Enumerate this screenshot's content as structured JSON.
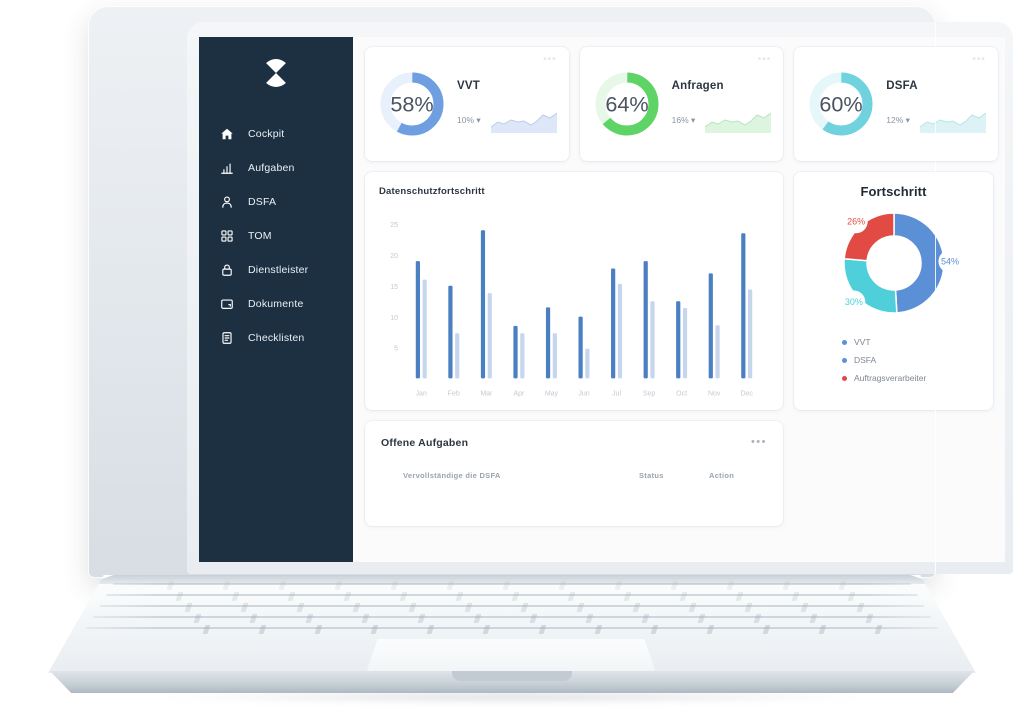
{
  "sidebar": {
    "logo_name": "brand-logo",
    "items": [
      {
        "label": "Cockpit",
        "icon": "home-icon"
      },
      {
        "label": "Aufgaben",
        "icon": "bar-chart-icon"
      },
      {
        "label": "DSFA",
        "icon": "user-icon"
      },
      {
        "label": "TOM",
        "icon": "grid-icon"
      },
      {
        "label": "Dienstleister",
        "icon": "lock-icon"
      },
      {
        "label": "Dokumente",
        "icon": "folder-icon"
      },
      {
        "label": "Checklisten",
        "icon": "document-icon"
      }
    ]
  },
  "stat_cards": [
    {
      "title": "VVT",
      "percent": "58%",
      "value": 58,
      "delta": "10% ▾",
      "color": "#6f9fe0",
      "track": "#e8f0fb",
      "menu": "•••"
    },
    {
      "title": "Anfragen",
      "percent": "64%",
      "value": 64,
      "delta": "16% ▾",
      "color": "#5ed366",
      "track": "#e7f8e9",
      "menu": "•••"
    },
    {
      "title": "DSFA",
      "percent": "60%",
      "value": 60,
      "delta": "12% ▾",
      "color": "#6fd2de",
      "track": "#e6f7fa",
      "menu": "•••"
    }
  ],
  "chart_data": [
    {
      "type": "bar",
      "title": "Datenschutzfortschritt",
      "categories": [
        "Jan",
        "Feb",
        "Mar",
        "Apr",
        "May",
        "Jun",
        "Jul",
        "Sep",
        "Oct",
        "Nov",
        "Dec"
      ],
      "series": [
        {
          "name": "primary",
          "color": "#4a7fc1",
          "values": [
            19,
            15,
            24,
            8.5,
            11.5,
            10,
            17.8,
            19,
            12.5,
            17,
            23.5
          ]
        },
        {
          "name": "secondary",
          "color": "#c6d7ed",
          "values": [
            16,
            7.3,
            13.8,
            7.3,
            7.3,
            4.8,
            15.3,
            12.5,
            11.4,
            8.6,
            14.4
          ]
        }
      ],
      "yticks": [
        5,
        10,
        15,
        20,
        25
      ],
      "ylim": [
        0,
        27
      ],
      "xlabel": "",
      "ylabel": "",
      "grid": false,
      "legend": "none"
    },
    {
      "type": "pie",
      "title": "Fortschritt",
      "labels": [
        "54%",
        "30%",
        "26%"
      ],
      "values": [
        54,
        30,
        26
      ],
      "colors": [
        "#5b8fd6",
        "#4ecfda",
        "#e24b44"
      ],
      "legend": [
        {
          "label": "VVT",
          "color": "#5b8fd6"
        },
        {
          "label": "DSFA",
          "color": "#5b8fd6"
        },
        {
          "label": "Auftragsverarbeiter",
          "color": "#e24b44"
        }
      ],
      "legend_position": "bottom-left"
    }
  ],
  "tasks": {
    "title": "Offene Aufgaben",
    "menu": "•••",
    "columns": {
      "task": "Vervollständige die DSFA",
      "status": "Status",
      "action": "Action"
    }
  }
}
